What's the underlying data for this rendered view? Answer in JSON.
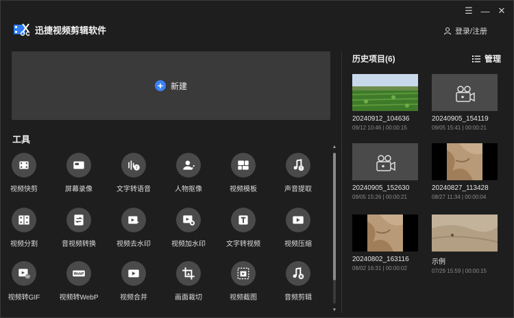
{
  "app": {
    "title": "迅捷视频剪辑软件",
    "login": "登录/注册"
  },
  "window": {
    "menu": "☰",
    "minimize": "—",
    "close": "✕"
  },
  "new_project": {
    "label": "新建"
  },
  "tools_section": {
    "title": "工具"
  },
  "tools": [
    {
      "label": "视频快剪",
      "icon": "film-icon"
    },
    {
      "label": "屏幕录像",
      "icon": "screen-record-icon"
    },
    {
      "label": "文字转语音",
      "icon": "text-to-speech-icon"
    },
    {
      "label": "人物抠像",
      "icon": "portrait-cutout-icon"
    },
    {
      "label": "视频模板",
      "icon": "template-icon"
    },
    {
      "label": "声音提取",
      "icon": "audio-extract-icon"
    },
    {
      "label": "视频分割",
      "icon": "split-icon"
    },
    {
      "label": "音视频转换",
      "icon": "convert-icon"
    },
    {
      "label": "视频去水印",
      "icon": "remove-watermark-icon"
    },
    {
      "label": "视频加水印",
      "icon": "add-watermark-icon"
    },
    {
      "label": "文字转视频",
      "icon": "text-to-video-icon"
    },
    {
      "label": "视频压缩",
      "icon": "compress-icon"
    },
    {
      "label": "视频转GIF",
      "icon": "gif-icon"
    },
    {
      "label": "视频转WebP",
      "icon": "webp-icon"
    },
    {
      "label": "视频合并",
      "icon": "merge-icon"
    },
    {
      "label": "画面裁切",
      "icon": "crop-icon"
    },
    {
      "label": "视频截图",
      "icon": "screenshot-icon"
    },
    {
      "label": "音频剪辑",
      "icon": "audio-edit-icon"
    }
  ],
  "history": {
    "title": "历史项目(6)",
    "manage": "管理",
    "items": [
      {
        "name": "20240912_104636",
        "meta": "09/12 10:46 | 00:00:15",
        "thumb": "field"
      },
      {
        "name": "20240905_154119",
        "meta": "09/05 15:41 | 00:00:21",
        "thumb": "camera"
      },
      {
        "name": "20240905_152630",
        "meta": "09/05 15:26 | 00:00:21",
        "thumb": "camera"
      },
      {
        "name": "20240827_113428",
        "meta": "08/27 11:34 | 00:00:04",
        "thumb": "sand"
      },
      {
        "name": "20240802_163116",
        "meta": "08/02 16:31 | 00:00:02",
        "thumb": "sand"
      },
      {
        "name": "示例",
        "meta": "07/29 15:59 | 00:00:15",
        "thumb": "desert"
      }
    ]
  }
}
